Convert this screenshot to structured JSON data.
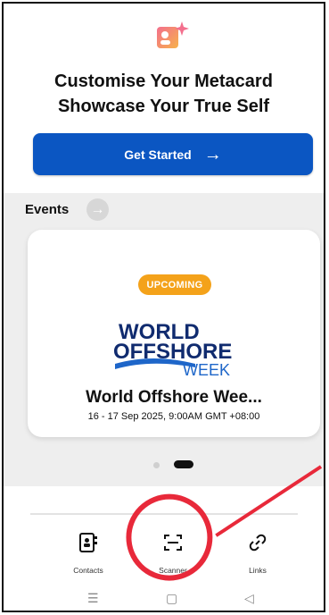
{
  "header": {
    "headline_line1": "Customise Your Metacard",
    "headline_line2": "Showcase Your True Self",
    "cta_label": "Get Started",
    "cta_arrow": "→"
  },
  "events": {
    "title": "Events",
    "next_arrow": "→",
    "card": {
      "badge": "UPCOMING",
      "brand_line1": "WORLD",
      "brand_line2": "OFFSHORE",
      "brand_line3": "WEEK",
      "title": "World Offshore Wee...",
      "subtitle": "16 - 17 Sep 2025, 9:00AM GMT +08:00"
    }
  },
  "nav": {
    "items": [
      {
        "label": "Contacts",
        "icon": "contacts-icon"
      },
      {
        "label": "Scanner",
        "icon": "scanner-icon"
      },
      {
        "label": "Links",
        "icon": "link-icon"
      }
    ]
  },
  "colors": {
    "accent": "#0b56c2",
    "badge": "#f4a21a",
    "annotation": "#e8293a"
  }
}
